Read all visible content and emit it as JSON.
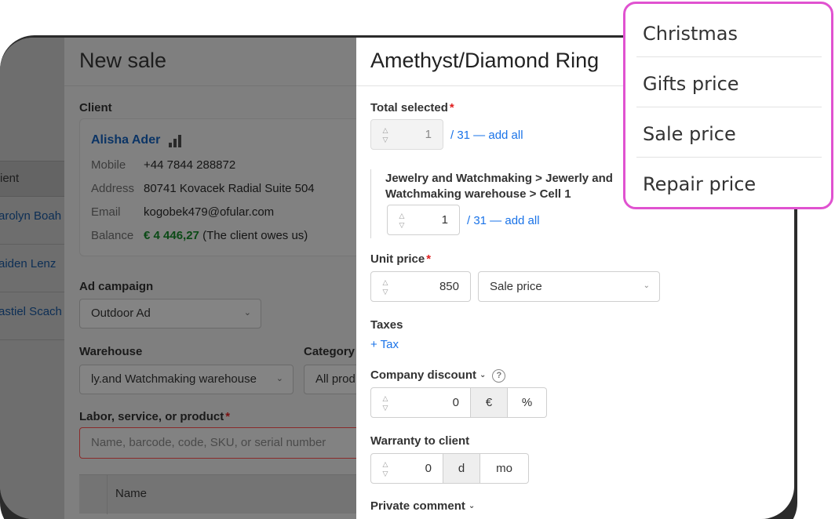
{
  "list": {
    "header": "ient",
    "rows": [
      "arolyn Boah",
      "aiden Lenz",
      "astiel Scach"
    ]
  },
  "sale": {
    "title": "New sale",
    "client_label": "Client",
    "client": {
      "name": "Alisha Ader",
      "mobile_label": "Mobile",
      "mobile": "+44 7844 288872",
      "address_label": "Address",
      "address": "80741 Kovacek Radial Suite 504",
      "email_label": "Email",
      "email": "kogobek479@ofular.com",
      "balance_label": "Balance",
      "balance": "€ 4 446,27",
      "balance_note": "(The client owes us)"
    },
    "ad_campaign_label": "Ad campaign",
    "ad_campaign": "Outdoor Ad",
    "warehouse_label": "Warehouse",
    "warehouse": "ly.and Watchmaking warehouse",
    "category_label": "Category",
    "category": "All prod",
    "product_label": "Labor, service, or product",
    "product_placeholder": "Name, barcode, code, SKU, or serial number",
    "table_name_header": "Name"
  },
  "product": {
    "title": "Amethyst/Diamond Ring",
    "total_selected_label": "Total selected",
    "total_selected": "1",
    "total_add_all": "/ 31 — add all",
    "location": "Jewelry and Watchmaking > Jewerly and Watchmaking warehouse > Cell 1",
    "location_qty": "1",
    "location_add_all": "/ 31 — add all",
    "unit_price_label": "Unit price",
    "unit_price": "850",
    "price_type": "Sale price",
    "taxes_label": "Taxes",
    "add_tax": "+ Tax",
    "company_discount_label": "Company discount",
    "discount_value": "0",
    "discount_units": [
      "€",
      "%"
    ],
    "warranty_label": "Warranty to client",
    "warranty_value": "0",
    "warranty_units": [
      "d",
      "mo"
    ],
    "private_comment_label": "Private comment"
  },
  "price_menu": {
    "items": [
      "Christmas",
      "Gifts price",
      "Sale price",
      "Repair price"
    ]
  },
  "colors": {
    "accent_link": "#1a73e8",
    "menu_highlight": "#e052d0",
    "required": "#e02020",
    "balance_positive": "#0b4a16"
  }
}
